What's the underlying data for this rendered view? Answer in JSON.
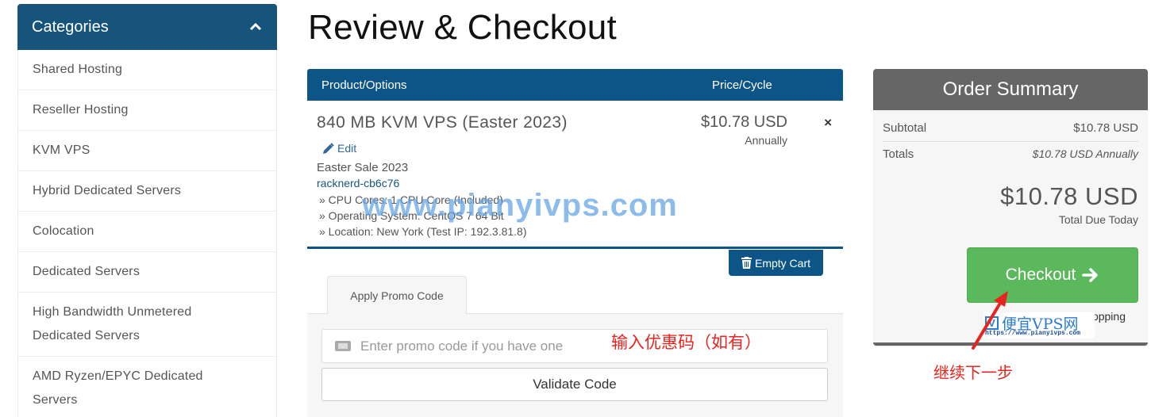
{
  "sidebar": {
    "title": "Categories",
    "items": [
      {
        "label": "Shared Hosting"
      },
      {
        "label": "Reseller Hosting"
      },
      {
        "label": "KVM VPS"
      },
      {
        "label": "Hybrid Dedicated Servers"
      },
      {
        "label": "Colocation"
      },
      {
        "label": "Dedicated Servers"
      },
      {
        "label": "High Bandwidth Unmetered Dedicated Servers"
      },
      {
        "label": "AMD Ryzen/EPYC Dedicated Servers"
      }
    ]
  },
  "page": {
    "title": "Review & Checkout"
  },
  "cart": {
    "headers": {
      "product": "Product/Options",
      "price": "Price/Cycle"
    },
    "items": [
      {
        "name": "840 MB KVM VPS (Easter 2023)",
        "edit_label": "Edit",
        "group": "Easter Sale 2023",
        "domain": "racknerd-cb6c76",
        "options": [
          "» CPU Cores: 1 CPU Core (Included)",
          "» Operating System: CentOS 7 64 Bit",
          "» Location: New York (Test IP: 192.3.81.8)"
        ],
        "price": "$10.78 USD",
        "cycle": "Annually",
        "remove_symbol": "×"
      }
    ],
    "empty_cart_label": "Empty Cart"
  },
  "promo": {
    "tab_label": "Apply Promo Code",
    "input_placeholder": "Enter promo code if you have one",
    "input_value": "",
    "validate_label": "Validate Code"
  },
  "summary": {
    "title": "Order Summary",
    "subtotal_label": "Subtotal",
    "subtotal_value": "$10.78 USD",
    "totals_label": "Totals",
    "totals_value": "$10.78 USD Annually",
    "due_amount": "$10.78 USD",
    "due_label": "Total Due Today",
    "checkout_label": "Checkout",
    "continue_label": "Continue Shopping"
  },
  "annotations": {
    "watermark": "www.pianyivps.com",
    "promo_note": "输入优惠码（如有）",
    "next_note": "继续下一步",
    "logo_text": "便宜VPS网",
    "logo_letter": "V",
    "logo_url": "https://www.pianyivps.com"
  },
  "colors": {
    "primary": "#0e5587",
    "sidebar_header": "#17547c",
    "success": "#5cb85c",
    "summary_header": "#666666",
    "annotation_red": "#e8241f"
  }
}
